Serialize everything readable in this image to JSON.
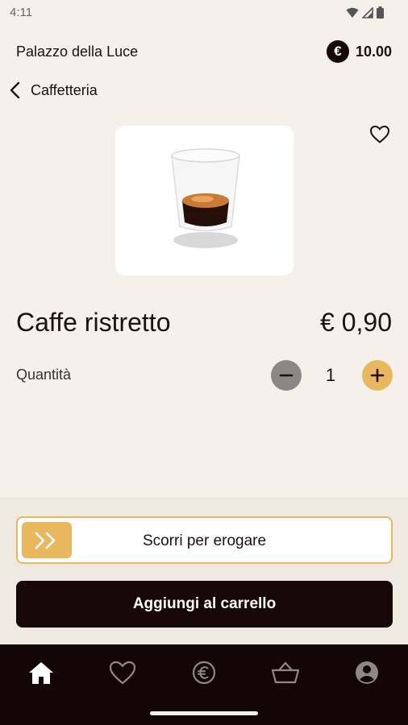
{
  "status": {
    "time": "4:11"
  },
  "header": {
    "venue": "Palazzo della Luce",
    "currency_symbol": "€",
    "balance": "10.00"
  },
  "nav": {
    "back_label": "Caffetteria"
  },
  "product": {
    "name": "Caffe ristretto",
    "price": "€ 0,90",
    "image": "espresso-glass",
    "favorited": false
  },
  "quantity": {
    "label": "Quantità",
    "value": "1"
  },
  "actions": {
    "slider_label": "Scorri per erogare",
    "add_to_cart": "Aggiungi al carrello"
  },
  "tabs": [
    {
      "name": "home",
      "icon": "home-icon",
      "active": true
    },
    {
      "name": "favorites",
      "icon": "heart-icon",
      "active": false
    },
    {
      "name": "wallet",
      "icon": "euro-circle-icon",
      "active": false
    },
    {
      "name": "cart",
      "icon": "basket-icon",
      "active": false
    },
    {
      "name": "profile",
      "icon": "user-icon",
      "active": false
    }
  ],
  "colors": {
    "accent": "#e9b85e",
    "dark": "#170707",
    "background": "#f5f0ea"
  }
}
